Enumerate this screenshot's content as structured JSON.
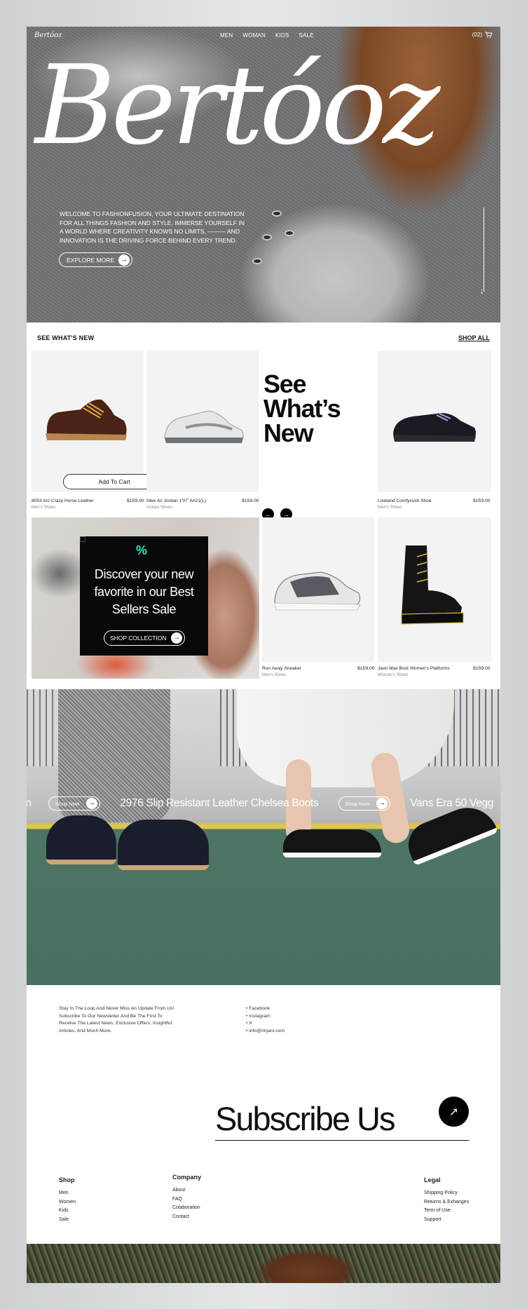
{
  "header": {
    "logo": "Bertóoz",
    "nav": [
      "MEN",
      "WOMAN",
      "KIDS",
      "SALE"
    ],
    "cart_count": "(02)"
  },
  "hero": {
    "title": "Bertóoz",
    "intro": "WELCOME TO FASHIONFUSION, YOUR ULTIMATE DESTINATION FOR ALL THINGS FASHION AND STYLE. IMMERSE YOURSELF IN A WORLD WHERE CREATIVITY KNOWS NO LIMITS, ——— AND INNOVATION IS THE DRIVING FORCE BEHIND EVERY TREND.",
    "explore_label": "EXPLORE MORE"
  },
  "new_section": {
    "heading": "SEE WHAT'S NEW",
    "shop_all": "SHOP ALL",
    "big_text": [
      "See",
      "What’s",
      "New"
    ],
    "add_to_cart": "Add To Cart",
    "products": [
      {
        "name": "8053 Arc Crazy Horse Leather",
        "category": "Men's Shoes",
        "price": "$159.00"
      },
      {
        "name": "Nike Air Jordan 1'07' Ari21(L)",
        "category": "Unisex Shoes",
        "price": "$159.00"
      },
      {
        "name": "Lowland Comfycush Shoe",
        "category": "Men's Shoes",
        "price": "$159.00"
      },
      {
        "name": "Run Away Sneaker",
        "category": "Men's Shoes",
        "price": "$159.00"
      },
      {
        "name": "Jaon Max Boot Women's Platforms",
        "category": "Woman's Shoes",
        "price": "$159.00"
      }
    ]
  },
  "promo": {
    "badge": "%",
    "text": "Discover your new favorite in our Best Sellers Sale",
    "cta": "SHOP COLLECTION"
  },
  "banner": {
    "marquee_left_fragment": "an",
    "shop_now": "Shop Now",
    "product_1": "2976 Slip Resistant Leather Chelsea Boots",
    "product_2": "Vans Era 50 Vegg"
  },
  "newsletter": {
    "text": "Stay In The Loop And Never Miss An Update From Us! Subscribe To Our Newsletter And Be The First To Receive The Latest News, Exclusive Offers, Insightful Articles, And Much More.",
    "social": [
      "Facebook",
      "Instagram",
      "X",
      "info@rinjani.com"
    ],
    "subscribe": "Subscribe Us"
  },
  "footer": {
    "shop": {
      "title": "Shop",
      "items": [
        "Men",
        "Women",
        "Kids",
        "Sale"
      ]
    },
    "company": {
      "title": "Company",
      "items": [
        "About",
        "FAQ",
        "Colaboration",
        "Contact"
      ]
    },
    "legal": {
      "title": "Legal",
      "items": [
        "Shipping Policy",
        "Returns & Exhanges",
        "Term of Use",
        "Support"
      ]
    }
  },
  "colors": {
    "accent": "#2ee6c0",
    "dark": "#090909",
    "banner_floor": "#4a7060"
  }
}
